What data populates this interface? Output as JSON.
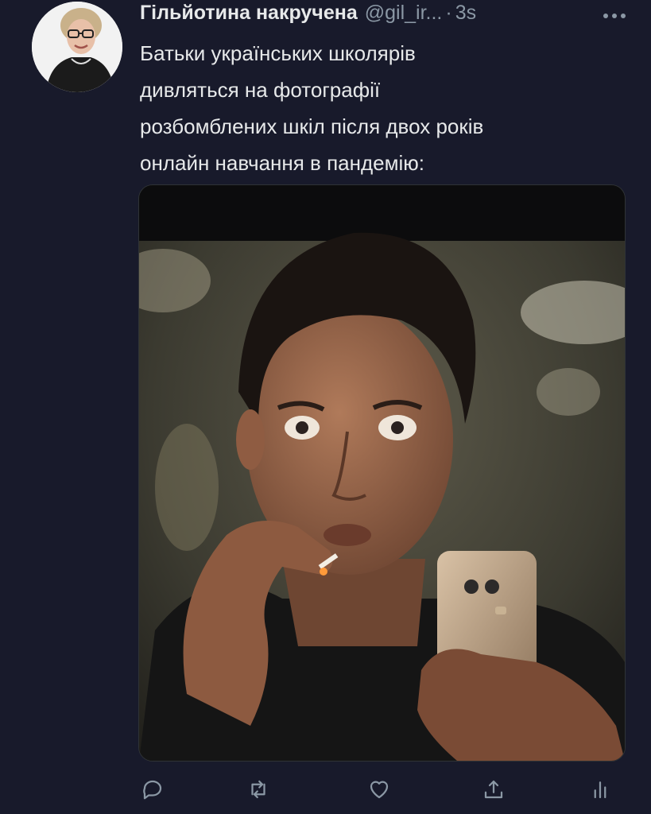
{
  "tweet": {
    "display_name": "Гільйотина накручена",
    "handle": "@gil_ir...",
    "separator": "·",
    "time": "3s",
    "text": "Батьки українських школярів\nдивляться на фотографії\nрозбомблених шкіл після двох років\nонлайн навчання в пандемію:"
  },
  "icons": {
    "avatar": "user-avatar",
    "more": "more-horizontal-icon",
    "reply": "reply-icon",
    "retweet": "retweet-icon",
    "like": "heart-icon",
    "share": "share-icon",
    "analytics": "analytics-icon"
  },
  "colors": {
    "background": "#181a2b",
    "text": "#e7e9ea",
    "secondary": "#8b98a5"
  }
}
